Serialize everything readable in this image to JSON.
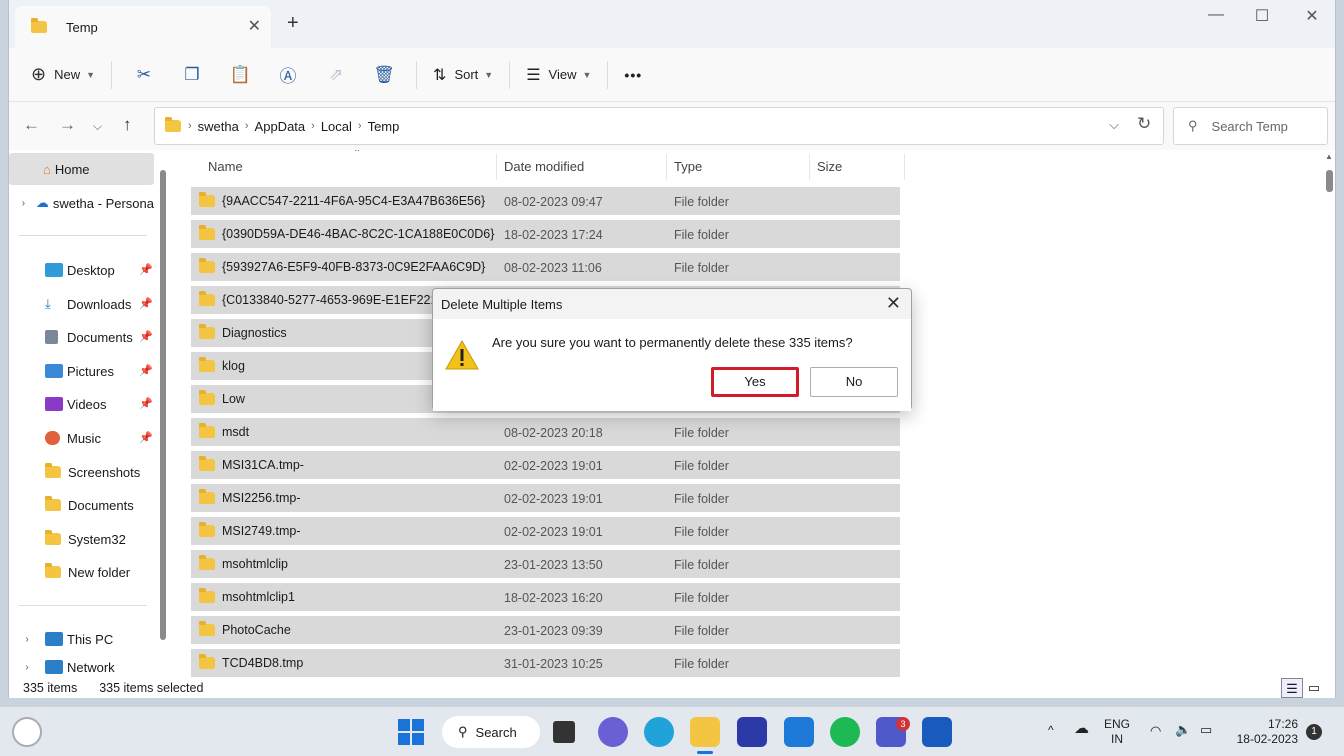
{
  "window": {
    "tab_title": "Temp",
    "new_tab": "+",
    "controls": {
      "minimize": "—",
      "maximize": "☐",
      "close": "✕"
    }
  },
  "toolbar": {
    "new_label": "New",
    "sort_label": "Sort",
    "view_label": "View",
    "more": "•••"
  },
  "address": {
    "crumbs": [
      "swetha",
      "AppData",
      "Local",
      "Temp"
    ],
    "search_placeholder": "Search Temp"
  },
  "sidebar": {
    "home": "Home",
    "onedrive": "swetha - Persona",
    "pinned": [
      "Desktop",
      "Downloads",
      "Documents",
      "Pictures",
      "Videos",
      "Music"
    ],
    "folders": [
      "Screenshots",
      "Documents",
      "System32",
      "New folder"
    ],
    "this_pc": "This PC",
    "network": "Network"
  },
  "columns": {
    "name": "Name",
    "date": "Date modified",
    "type": "Type",
    "size": "Size"
  },
  "files": [
    {
      "name": "{9AACC547-2211-4F6A-95C4-E3A47B636E56}",
      "date": "08-02-2023 09:47",
      "type": "File folder"
    },
    {
      "name": "{0390D59A-DE46-4BAC-8C2C-1CA188E0C0D6}",
      "date": "18-02-2023 17:24",
      "type": "File folder"
    },
    {
      "name": "{593927A6-E5F9-40FB-8373-0C9E2FAA6C9D}",
      "date": "08-02-2023 11:06",
      "type": "File folder"
    },
    {
      "name": "{C0133840-5277-4653-969E-E1EF221B",
      "date": "",
      "type": ""
    },
    {
      "name": "Diagnostics",
      "date": "",
      "type": ""
    },
    {
      "name": "klog",
      "date": "",
      "type": ""
    },
    {
      "name": "Low",
      "date": "",
      "type": ""
    },
    {
      "name": "msdt",
      "date": "08-02-2023 20:18",
      "type": "File folder"
    },
    {
      "name": "MSI31CA.tmp-",
      "date": "02-02-2023 19:01",
      "type": "File folder"
    },
    {
      "name": "MSI2256.tmp-",
      "date": "02-02-2023 19:01",
      "type": "File folder"
    },
    {
      "name": "MSI2749.tmp-",
      "date": "02-02-2023 19:01",
      "type": "File folder"
    },
    {
      "name": "msohtmlclip",
      "date": "23-01-2023 13:50",
      "type": "File folder"
    },
    {
      "name": "msohtmlclip1",
      "date": "18-02-2023 16:20",
      "type": "File folder"
    },
    {
      "name": "PhotoCache",
      "date": "23-01-2023 09:39",
      "type": "File folder"
    },
    {
      "name": "TCD4BD8.tmp",
      "date": "31-01-2023 10:25",
      "type": "File folder"
    }
  ],
  "status": {
    "count": "335 items",
    "selected": "335 items selected"
  },
  "dialog": {
    "title": "Delete Multiple Items",
    "message": "Are you sure you want to permanently delete these 335 items?",
    "yes": "Yes",
    "no": "No",
    "highlight_color": "#d11a2a"
  },
  "taskbar": {
    "search_label": "Search",
    "teams_badge": "3",
    "lang_line1": "ENG",
    "lang_line2": "IN",
    "time": "17:26",
    "date": "18-02-2023",
    "notification_count": "1"
  }
}
